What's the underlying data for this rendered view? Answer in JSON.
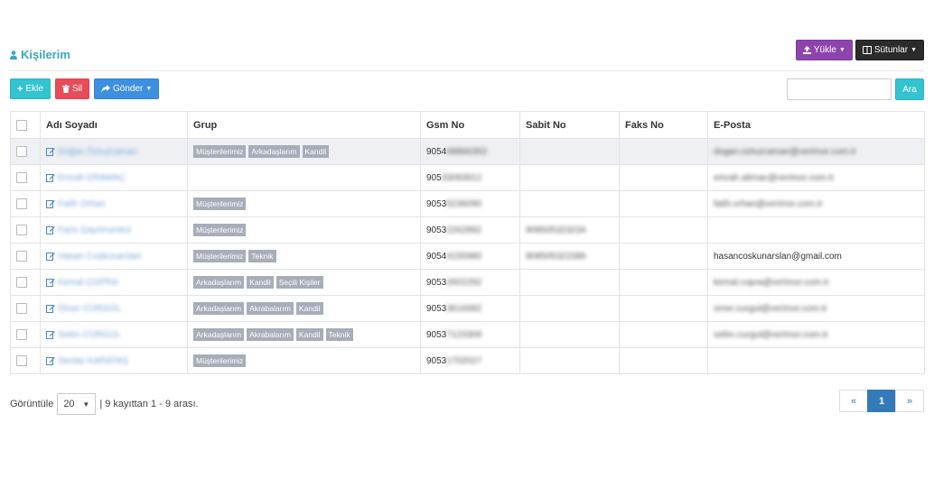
{
  "page": {
    "title": "Kişilerim",
    "upload_label": "Yükle",
    "columns_label": "Sütunlar"
  },
  "toolbar": {
    "add_label": "Ekle",
    "delete_label": "Sil",
    "send_label": "Gönder",
    "search_placeholder": "",
    "search_button": "Ara"
  },
  "table": {
    "headers": [
      "Adı Soyadı",
      "Grup",
      "Gsm No",
      "Sabit No",
      "Faks No",
      "E-Posta"
    ],
    "rows": [
      {
        "name": "Doğan Öztuzcaman",
        "groups": [
          "Müşterilerimiz",
          "Arkadaşlarım",
          "Kandil"
        ],
        "gsm_prefix": "9054",
        "gsm_rest": "68866353",
        "sabit": "",
        "faks": "",
        "email": "dogan.oztuzcaman@verimor.com.tr"
      },
      {
        "name": "Emrah ERAMAÇ",
        "groups": [],
        "gsm_prefix": "905",
        "gsm_rest": "33093912",
        "sabit": "",
        "faks": "",
        "email": "emrah.alimac@verimor.com.tr"
      },
      {
        "name": "Fatih Orhan",
        "groups": [
          "Müşterilerimiz"
        ],
        "gsm_prefix": "9053",
        "gsm_rest": "5236090",
        "sabit": "",
        "faks": "",
        "email": "fatih.orhan@verimor.com.tr"
      },
      {
        "name": "Faris Gayrimenkul",
        "groups": [
          "Müşterilerimiz"
        ],
        "gsm_prefix": "9053",
        "gsm_rest": "2262892",
        "sabit": "908505323234",
        "faks": "",
        "email": ""
      },
      {
        "name": "Hasan Coşkunarslan",
        "groups": [
          "Müşterilerimiz",
          "Teknik"
        ],
        "gsm_prefix": "9054",
        "gsm_rest": "4155980",
        "sabit": "908505321586",
        "faks": "",
        "email": "hasancoskunarslan@gmail.com"
      },
      {
        "name": "Kemal ÇOPRA",
        "groups": [
          "Arkadaşlarım",
          "Kandil",
          "Seçili Kişiler"
        ],
        "gsm_prefix": "9053",
        "gsm_rest": "2602292",
        "sabit": "",
        "faks": "",
        "email": "kemal.copra@verimor.com.tr"
      },
      {
        "name": "Ömer CÜRGÜL",
        "groups": [
          "Arkadaşlarım",
          "Akrabalarım",
          "Kandil"
        ],
        "gsm_prefix": "9053",
        "gsm_rest": "3616682",
        "sabit": "",
        "faks": "",
        "email": "omer.curgul@verimor.com.tr"
      },
      {
        "name": "Selim CÜRGÜL",
        "groups": [
          "Arkadaşlarım",
          "Akrabalarım",
          "Kandil",
          "Teknik"
        ],
        "gsm_prefix": "9053",
        "gsm_rest": "7123309",
        "sabit": "",
        "faks": "",
        "email": "selim.curgul@verimor.com.tr"
      },
      {
        "name": "Serdar KARATAŞ",
        "groups": [
          "Müşterilerimiz"
        ],
        "gsm_prefix": "9053",
        "gsm_rest": "1702027",
        "sabit": "",
        "faks": "",
        "email": ""
      }
    ]
  },
  "footer": {
    "show_label": "Görüntüle",
    "page_size": "20",
    "summary": "| 9 kayıttan 1 - 9 arası.",
    "prev": "«",
    "current_page": "1",
    "next": "»"
  },
  "colors": {
    "accent": "#3aa6c2",
    "upload": "#8e44ad",
    "columns": "#2b2b2b",
    "add": "#33c3d1",
    "delete": "#e74c5a",
    "send": "#3d8fe0",
    "tag": "#a7adb9"
  },
  "icons": {
    "title": "user-icon",
    "upload": "upload-icon",
    "columns": "columns-icon",
    "add": "plus-icon",
    "delete": "trash-icon",
    "send": "share-icon",
    "edit": "edit-icon"
  }
}
